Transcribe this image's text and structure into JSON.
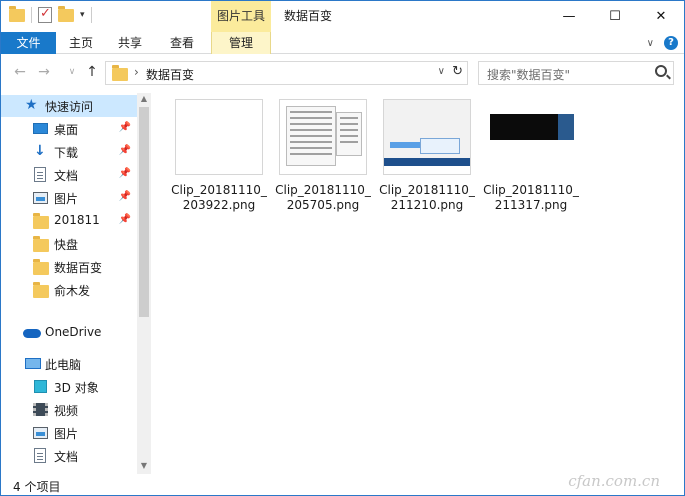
{
  "titlebar": {
    "context_tab_header": "图片工具",
    "window_title": "数据百变",
    "buttons": {
      "minimize": "—",
      "maximize": "☐",
      "close": "✕"
    }
  },
  "ribbon": {
    "tabs": [
      "文件",
      "主页",
      "共享",
      "查看",
      "管理"
    ],
    "help_glyph": "?"
  },
  "address": {
    "path": "数据百变",
    "search_placeholder": "搜索\"数据百变\""
  },
  "navpane": {
    "quick_access": "快速访问",
    "items": [
      {
        "label": "桌面",
        "icon": "desktop-icon",
        "pinned": true
      },
      {
        "label": "下载",
        "icon": "download-icon",
        "pinned": true
      },
      {
        "label": "文档",
        "icon": "document-icon",
        "pinned": true
      },
      {
        "label": "图片",
        "icon": "picture-icon",
        "pinned": true
      },
      {
        "label": "201811",
        "icon": "folder-icon",
        "pinned": true
      },
      {
        "label": "快盘",
        "icon": "folder-icon",
        "pinned": false
      },
      {
        "label": "数据百变",
        "icon": "folder-icon",
        "pinned": false
      },
      {
        "label": "俞木发",
        "icon": "folder-icon",
        "pinned": false
      }
    ],
    "onedrive": "OneDrive",
    "this_pc": "此电脑",
    "pc_items": [
      {
        "label": "3D 对象",
        "icon": "3d-objects-icon"
      },
      {
        "label": "视频",
        "icon": "video-icon"
      },
      {
        "label": "图片",
        "icon": "picture-icon"
      },
      {
        "label": "文档",
        "icon": "document-icon"
      }
    ]
  },
  "files": [
    {
      "name": "Clip_20181110_203922.png",
      "line1": "Clip_20181110_",
      "line2": "203922.png"
    },
    {
      "name": "Clip_20181110_205705.png",
      "line1": "Clip_20181110_",
      "line2": "205705.png"
    },
    {
      "name": "Clip_20181110_211210.png",
      "line1": "Clip_20181110_",
      "line2": "211210.png"
    },
    {
      "name": "Clip_20181110_211317.png",
      "line1": "Clip_20181110_",
      "line2": "211317.png"
    }
  ],
  "status": {
    "item_count": "4 个项目",
    "watermark": "cfan.com.cn"
  },
  "colors": {
    "accent": "#1979ca",
    "selected": "#cce8ff",
    "context_tab": "#fbeb9c",
    "folder": "#f4c95d"
  }
}
